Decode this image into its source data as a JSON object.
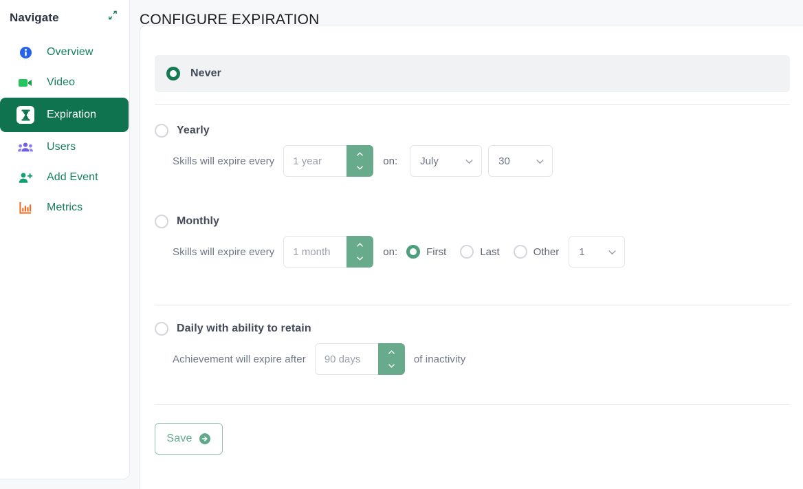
{
  "sidebar": {
    "title": "Navigate",
    "pin_icon": "collapse-arrows-icon",
    "items": [
      {
        "label": "Overview",
        "icon": "info-circle-icon",
        "active": false
      },
      {
        "label": "Video",
        "icon": "video-camera-icon",
        "active": false
      },
      {
        "label": "Expiration",
        "icon": "hourglass-icon",
        "active": true
      },
      {
        "label": "Users",
        "icon": "users-group-icon",
        "active": false
      },
      {
        "label": "Add Event",
        "icon": "user-plus-icon",
        "active": false
      },
      {
        "label": "Metrics",
        "icon": "bar-chart-icon",
        "active": false
      }
    ]
  },
  "main": {
    "page_title": "CONFIGURE EXPIRATION",
    "options": {
      "never": {
        "label": "Never",
        "selected": true
      },
      "yearly": {
        "label": "Yearly",
        "selected": false,
        "helper": "Skills will expire every",
        "amount_placeholder": "1 year",
        "amount_value": "",
        "on_label": "on:",
        "month_value": "July",
        "day_value": "30"
      },
      "monthly": {
        "label": "Monthly",
        "selected": false,
        "helper": "Skills will expire every",
        "amount_placeholder": "1 month",
        "amount_value": "",
        "on_label": "on:",
        "choices": [
          {
            "label": "First",
            "selected": true
          },
          {
            "label": "Last",
            "selected": false
          },
          {
            "label": "Other",
            "selected": false
          }
        ],
        "other_value": "1"
      },
      "daily": {
        "label": "Daily with ability to retain",
        "selected": false,
        "helper_before": "Achievement will expire after",
        "amount_placeholder": "90 days",
        "amount_value": "",
        "helper_after": "of inactivity"
      }
    },
    "save": {
      "label": "Save",
      "icon": "arrow-right-circle-icon"
    }
  },
  "colors": {
    "brand_dark_green": "#0f7350",
    "brand_green": "#15805a",
    "stepper_green": "#68ab8c",
    "radio_mid_green": "#4d9f7e",
    "row_highlight": "#f1f2f4",
    "page_bg": "#f7f8fa"
  }
}
